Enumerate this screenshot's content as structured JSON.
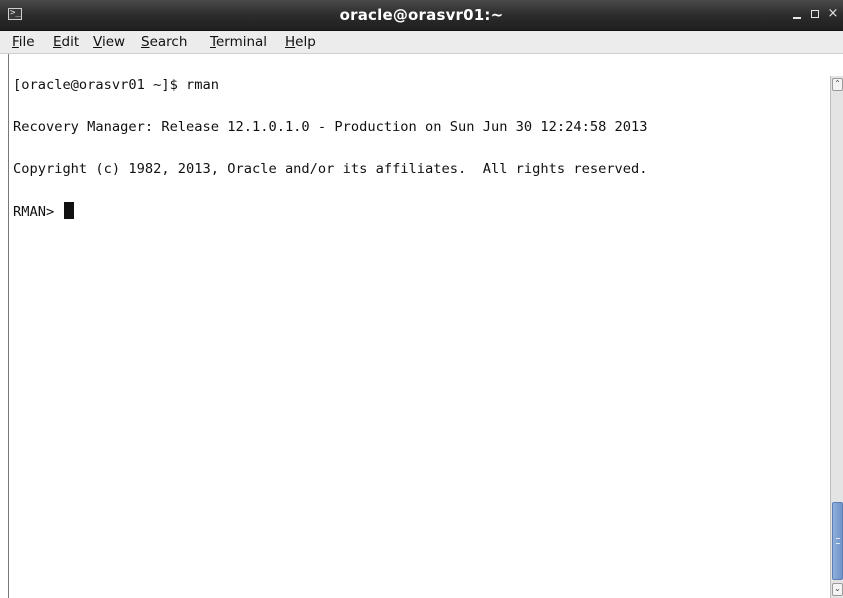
{
  "window": {
    "title": "oracle@orasvr01:~",
    "app_icon": "terminal-icon",
    "controls": {
      "minimize": "_",
      "maximize": "□",
      "close": "×"
    }
  },
  "menu": {
    "items": [
      {
        "accel": "F",
        "rest": "ile"
      },
      {
        "accel": "E",
        "rest": "dit"
      },
      {
        "accel": "V",
        "rest": "iew"
      },
      {
        "accel": "S",
        "rest": "earch"
      },
      {
        "accel": "T",
        "rest": "erminal"
      },
      {
        "accel": "H",
        "rest": "elp"
      }
    ]
  },
  "terminal": {
    "lines": [
      "[oracle@orasvr01 ~]$ rman",
      "Recovery Manager: Release 12.1.0.1.0 - Production on Sun Jun 30 12:24:58 2013",
      "Copyright (c) 1982, 2013, Oracle and/or its affiliates.  All rights reserved.",
      "RMAN> "
    ]
  },
  "scrollbar": {
    "up_glyph": "⌃",
    "down_glyph": "⌄"
  },
  "colors": {
    "titlebar": "#2c2c2c",
    "menubar": "#ececec",
    "terminal_bg": "#ffffff",
    "terminal_fg": "#111111",
    "scroll_thumb": "#7a9fd2"
  }
}
